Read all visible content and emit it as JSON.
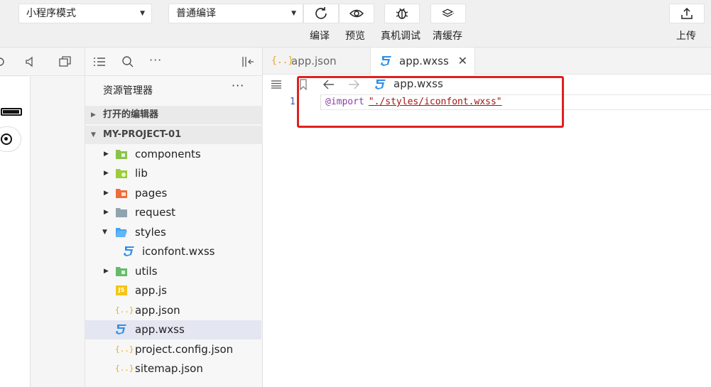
{
  "toolbar": {
    "mode_select": "小程序模式",
    "compile_select": "普通编译",
    "compile_label": "编译",
    "preview_label": "预览",
    "debug_label": "真机调试",
    "clear_cache_label": "清缓存",
    "upload_label": "上传"
  },
  "explorer": {
    "title": "资源管理器",
    "more": "···",
    "open_editors": "打开的编辑器",
    "project": "MY-PROJECT-01",
    "items": [
      {
        "label": "components",
        "kind": "folder"
      },
      {
        "label": "lib",
        "kind": "folder"
      },
      {
        "label": "pages",
        "kind": "folder"
      },
      {
        "label": "request",
        "kind": "folder"
      },
      {
        "label": "styles",
        "kind": "folder-open"
      },
      {
        "label": "iconfont.wxss",
        "kind": "wxss"
      },
      {
        "label": "utils",
        "kind": "folder"
      },
      {
        "label": "app.js",
        "kind": "js"
      },
      {
        "label": "app.json",
        "kind": "json"
      },
      {
        "label": "app.wxss",
        "kind": "wxss"
      },
      {
        "label": "project.config.json",
        "kind": "json"
      },
      {
        "label": "sitemap.json",
        "kind": "json"
      }
    ]
  },
  "editor": {
    "tabs": [
      {
        "label": "app.json",
        "icon": "{..}"
      },
      {
        "label": "app.wxss",
        "icon": "3",
        "close": "✕"
      }
    ],
    "breadcrumb_file": "app.wxss",
    "line_number": "1",
    "code_keyword": "@import",
    "code_string": "\"./styles/iconfont.wxss\""
  },
  "colors": {
    "wxss": "#2f8fe8",
    "json": "#e8a81a",
    "js": "#f5c518",
    "highlight": "#e02020"
  }
}
